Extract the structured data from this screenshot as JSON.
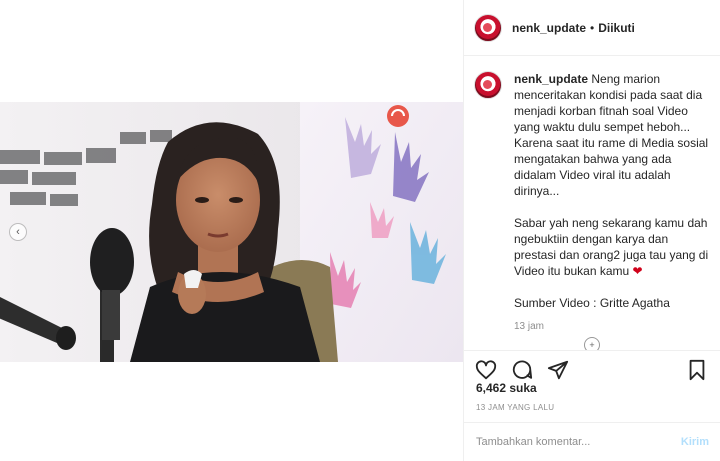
{
  "post": {
    "username": "nenk_update",
    "separator": "•",
    "follow_status": "Diikuti"
  },
  "caption": {
    "username": "nenk_update",
    "paragraph1": "Neng marion menceritakan kondisi pada saat dia menjadi korban fitnah soal Video yang waktu dulu sempet heboh... Karena saat itu rame di Media sosial mengatakan bahwa yang ada didalam Video viral itu adalah dirinya...",
    "paragraph2": "Sabar yah neng sekarang kamu dah ngebuktiin dengan karya dan prestasi dan orang2 juga tau yang di Video itu bukan kamu",
    "heart": "❤",
    "source": "Sumber Video : Gritte Agatha",
    "time": "13 jam"
  },
  "media": {
    "carousel_prev": "‹"
  },
  "stats": {
    "likes": "6,462 suka",
    "time_ago": "13 JAM YANG LALU"
  },
  "comment_box": {
    "placeholder": "Tambahkan komentar...",
    "post_label": "Kirim"
  },
  "icons": {
    "like": "heart-outline-icon",
    "comment": "comment-bubble-icon",
    "share": "paper-plane-icon",
    "save": "bookmark-icon"
  }
}
